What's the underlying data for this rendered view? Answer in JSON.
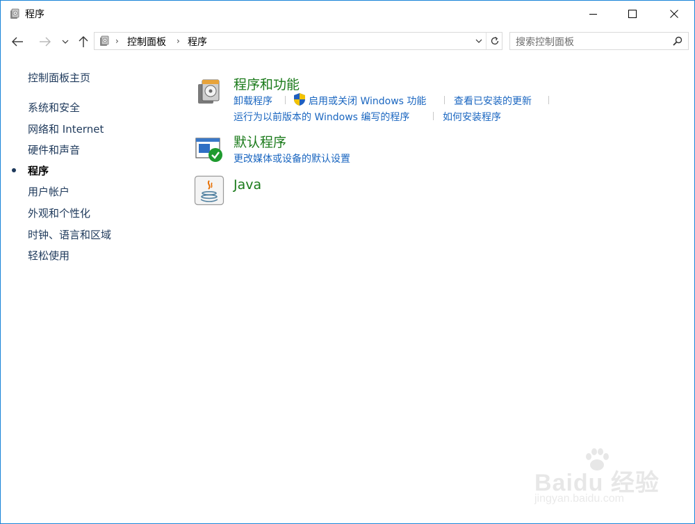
{
  "window": {
    "title": "程序",
    "icon": "control-panel-programs-icon"
  },
  "nav": {
    "back_icon": "arrow-left-icon",
    "forward_icon": "arrow-right-icon",
    "recent_icon": "chevron-down-icon",
    "up_icon": "arrow-up-icon"
  },
  "address": {
    "breadcrumbs": [
      "控制面板",
      "程序"
    ]
  },
  "search": {
    "placeholder": "搜索控制面板"
  },
  "sidebar": {
    "items": [
      {
        "label": "控制面板主页"
      },
      {
        "label": "系统和安全"
      },
      {
        "label": "网络和 Internet"
      },
      {
        "label": "硬件和声音"
      },
      {
        "label": "程序",
        "current": true
      },
      {
        "label": "用户帐户"
      },
      {
        "label": "外观和个性化"
      },
      {
        "label": "时钟、语言和区域"
      },
      {
        "label": "轻松使用"
      }
    ]
  },
  "categories": [
    {
      "title": "程序和功能",
      "icon": "programs-features-icon",
      "links": [
        "卸载程序",
        "启用或关闭 Windows 功能",
        "查看已安装的更新",
        "运行为以前版本的 Windows 编写的程序",
        "如何安装程序"
      ]
    },
    {
      "title": "默认程序",
      "icon": "default-programs-icon",
      "links": [
        "更改媒体或设备的默认设置"
      ]
    },
    {
      "title": "Java",
      "icon": "java-icon",
      "links": []
    }
  ],
  "watermark": {
    "line1": "Baidu 经验",
    "line2": "jingyan.baidu.com"
  },
  "colors": {
    "category_title": "#1a7a1a",
    "link": "#1a66c0",
    "sidebar_text": "#1e395b",
    "window_border": "#1883d7"
  }
}
